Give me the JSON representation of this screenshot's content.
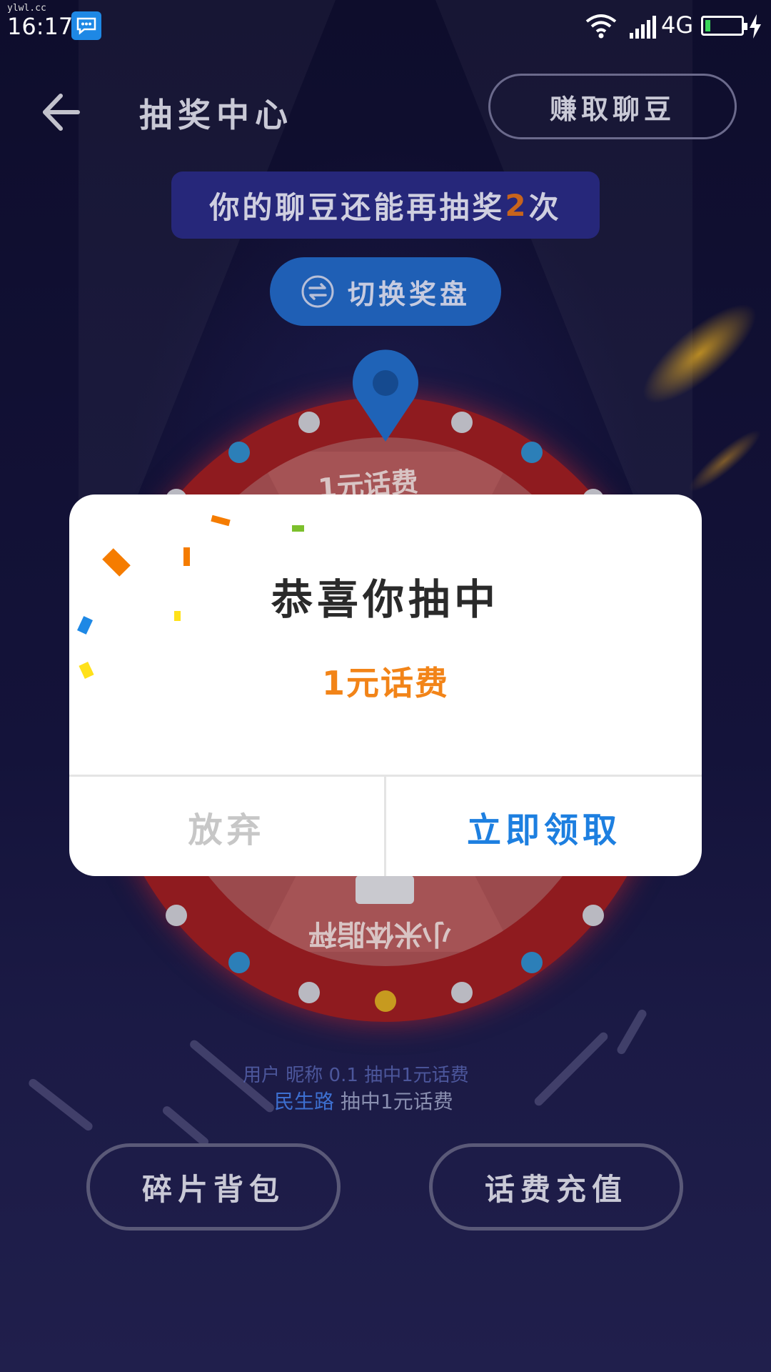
{
  "status_bar": {
    "watermark": "ylwl.cc",
    "time": "16:17",
    "network": "4G",
    "battery_level": 0.15
  },
  "header": {
    "title": "抽奖中心",
    "earn_button": "赚取聊豆"
  },
  "chances": {
    "prefix": "你的聊豆还能再抽奖",
    "count": "2",
    "suffix": "次"
  },
  "switch_button": "切换奖盘",
  "wheel": {
    "top_prize": "1元话费",
    "bottom_prize": "小米体脂秤"
  },
  "winners": [
    {
      "text": "用户 昵称 0.1 抽中1元话费"
    },
    {
      "name": "民生路",
      "text": " 抽中1元话费"
    }
  ],
  "bottom_buttons": [
    "碎片背包",
    "话费充值"
  ],
  "dialog": {
    "title": "恭喜你抽中",
    "prize": "1元话费",
    "cancel": "放弃",
    "confirm": "立即领取"
  },
  "colors": {
    "accent_blue": "#1d7fe0",
    "prize_orange": "#f28418",
    "wheel_red": "#8f1b1f"
  }
}
